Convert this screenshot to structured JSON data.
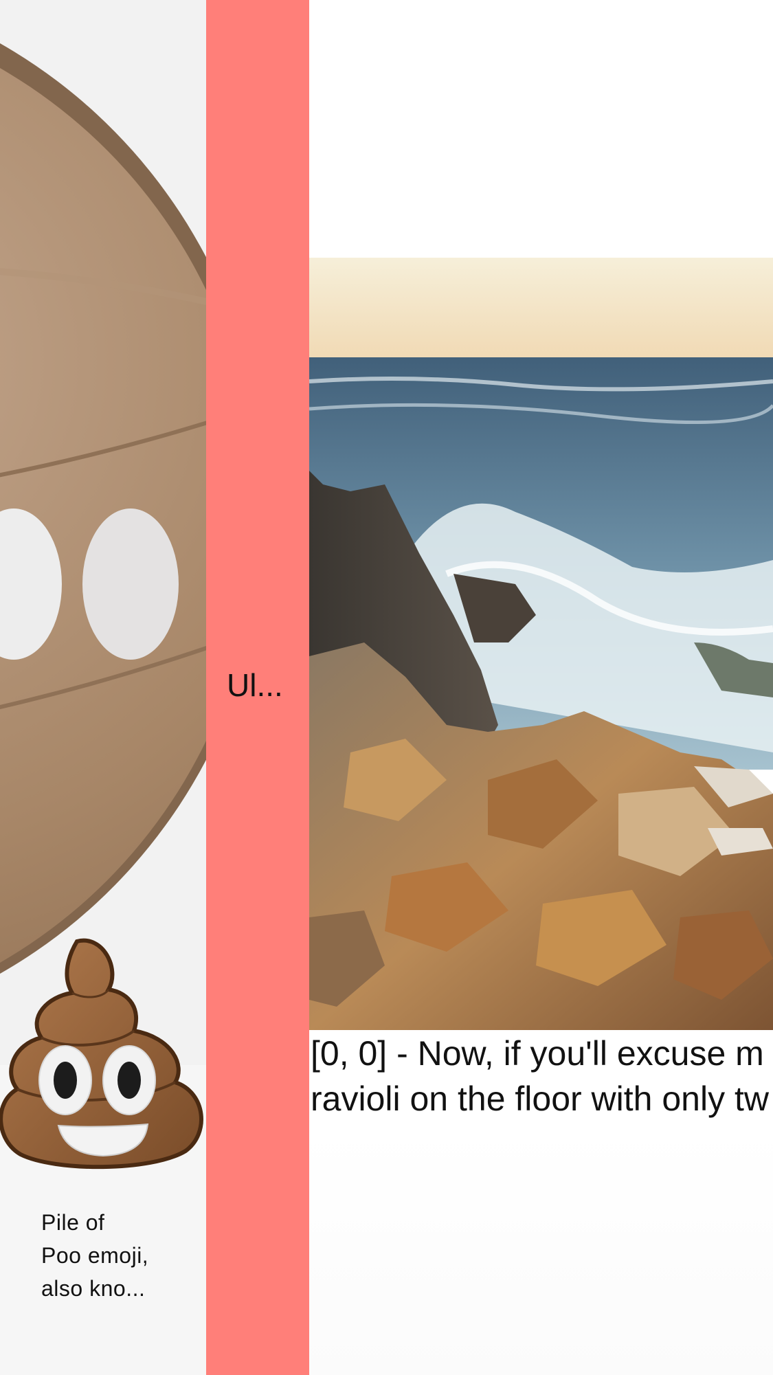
{
  "emoji_cell": {
    "emoji_name": "pile-of-poo-icon",
    "caption": "Pile of\nPoo emoji,\nalso kno..."
  },
  "divider": {
    "label": "Ul...",
    "color": "#ff7f79"
  },
  "photo_cell": {
    "image_subject": "rocky-coast-waves-photo",
    "caption_line_1": "[0, 0] - Now, if you'll excuse m",
    "caption_line_2": "ravioli on the floor with only tw"
  }
}
